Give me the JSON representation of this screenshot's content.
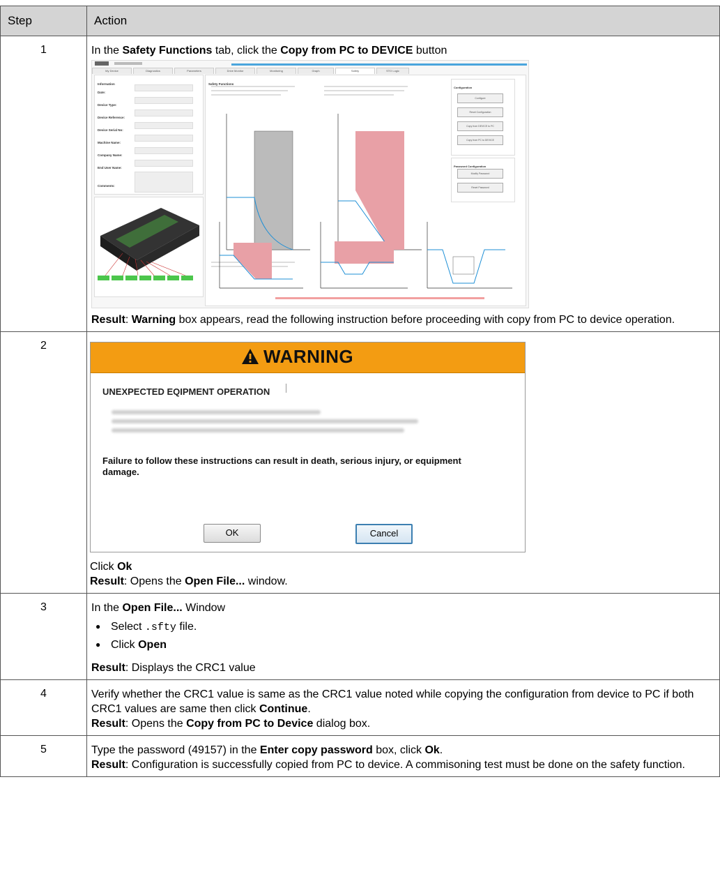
{
  "header": {
    "step": "Step",
    "action": "Action"
  },
  "steps": [
    {
      "num": "1",
      "intro": {
        "pre": "In the ",
        "tab": "Safety Functions",
        "mid": " tab, click the ",
        "button": "Copy from PC to DEVICE",
        "post": " button"
      },
      "result": {
        "label": "Result",
        "sep": ": ",
        "word": "Warning",
        "text": " box appears, read the following instruction before proceeding with copy from PC to device operation."
      }
    },
    {
      "num": "2",
      "click": {
        "pre": "Click ",
        "bold": "Ok"
      },
      "result": {
        "label": "Result",
        "pre": ": Opens the ",
        "bold": "Open File...",
        "post": " window."
      }
    },
    {
      "num": "3",
      "intro": {
        "pre": "In the ",
        "bold": "Open File...",
        "post": " Window"
      },
      "bullets": [
        {
          "pre": "Select ",
          "code": ".sfty",
          "post": " file."
        },
        {
          "pre": "Click ",
          "bold": "Open"
        }
      ],
      "result": {
        "label": "Result",
        "text": ": Displays the CRC1 value"
      }
    },
    {
      "num": "4",
      "text": "Verify whether the CRC1 value is same as the CRC1 value noted while copying the configuration from device to PC if both CRC1 values are same then click ",
      "bold": "Continue",
      "end": ".",
      "result": {
        "label": "Result",
        "pre": ": Opens the ",
        "bold": "Copy from PC to Device",
        "post": " dialog box."
      }
    },
    {
      "num": "5",
      "pre": "Type the password (49157) in the ",
      "bold": "Enter copy password",
      "post": " box, click ",
      "ok": "Ok",
      "end": ".",
      "result": {
        "label": "Result",
        "text": ": Configuration is successfully copied from PC to device. A commisoning test must be done on the safety function."
      }
    }
  ],
  "warning_dialog": {
    "title": "WARNING",
    "subtitle": "UNEXPECTED EQIPMENT OPERATION",
    "failure_text": "Failure to follow these instructions can result in death, serious injury, or equipment damage.",
    "ok_label": "OK",
    "cancel_label": "Cancel",
    "colors": {
      "header": "#f39c12",
      "cancel_border": "#3c7fb1"
    }
  },
  "safety_screenshot": {
    "safety_functions_title": "Safety Functions",
    "information_title": "Information",
    "fields": [
      "Date:",
      "Device Type:",
      "Device Reference:",
      "Device Serial No:",
      "Machine Name:",
      "Company Name:",
      "End User Name:",
      "Comments:"
    ],
    "configuration_title": "Configuration",
    "configuration_buttons": [
      "Configure",
      "Reset Configuration",
      "Copy from DEVICE to PC",
      "Copy from PC to DEVICE"
    ],
    "password_title": "Password Configuration",
    "password_buttons": [
      "Modify Password",
      "Reset Password"
    ],
    "tabs": [
      "My Device",
      "Diagnostics",
      "Parameters",
      "Drive Monitor",
      "Monitoring",
      "Graph",
      "Safety",
      "STO Logic"
    ],
    "active_tab": "Safety",
    "colors": {
      "accent_bar": "#4aa5dd",
      "red_fill": "#e8a0a6",
      "curve": "#1e8fd6"
    }
  }
}
